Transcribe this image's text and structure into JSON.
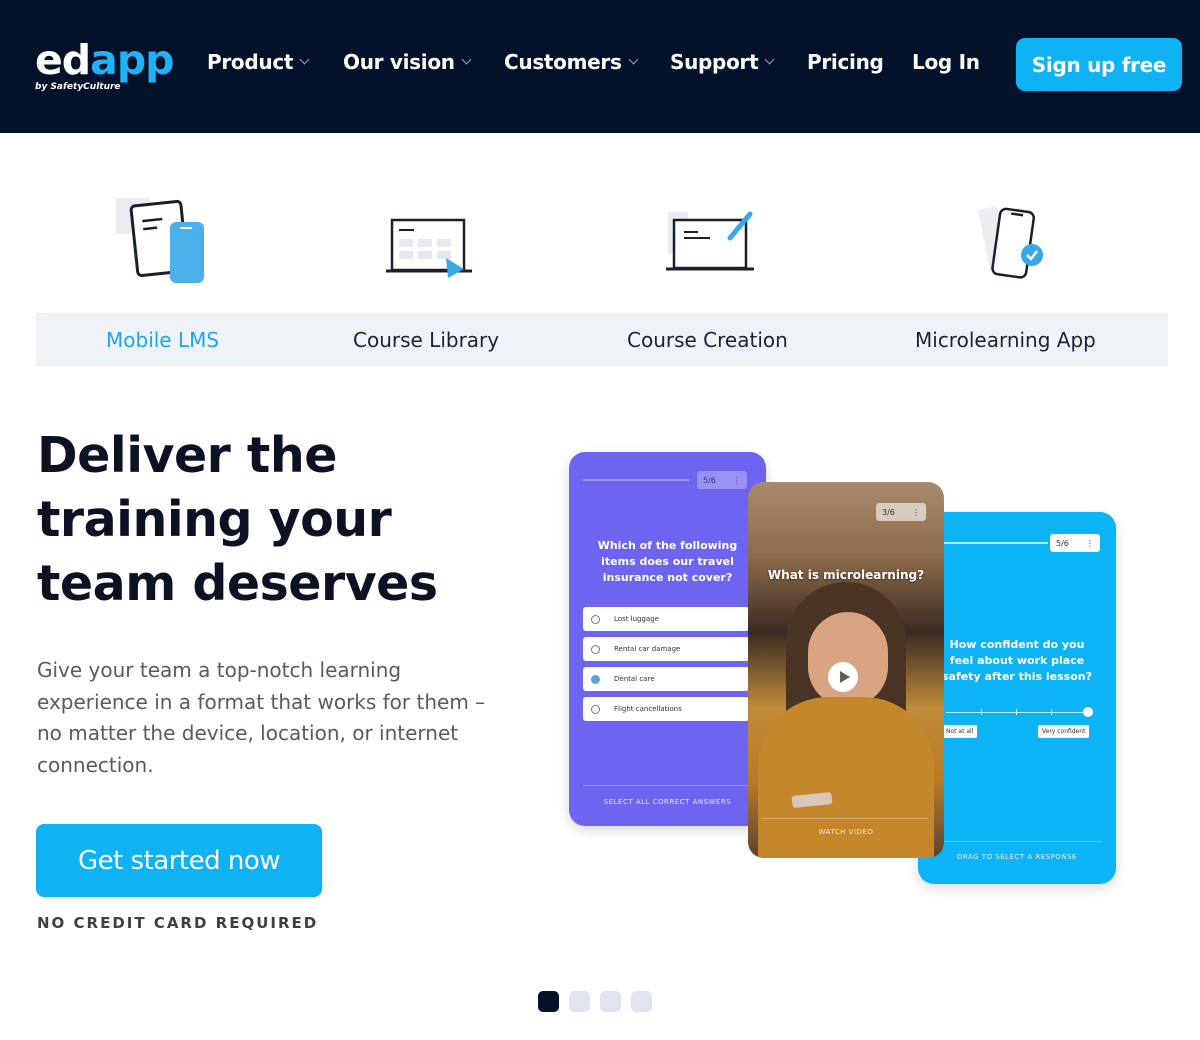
{
  "nav": {
    "logo": {
      "ed": "ed",
      "app": "app",
      "sub": "by SafetyCulture"
    },
    "items": [
      {
        "label": "Product",
        "dropdown": true
      },
      {
        "label": "Our vision",
        "dropdown": true
      },
      {
        "label": "Customers",
        "dropdown": true
      },
      {
        "label": "Support",
        "dropdown": true
      },
      {
        "label": "Pricing",
        "dropdown": false
      },
      {
        "label": "Log In",
        "dropdown": false
      }
    ],
    "signup_label": "Sign up free"
  },
  "product_tabs": [
    {
      "label": "Mobile LMS",
      "icon": "document-phone-icon",
      "active": true
    },
    {
      "label": "Course Library",
      "icon": "laptop-library-icon",
      "active": false
    },
    {
      "label": "Course Creation",
      "icon": "laptop-pen-icon",
      "active": false
    },
    {
      "label": "Microlearning App",
      "icon": "phone-check-icon",
      "active": false
    }
  ],
  "hero": {
    "title_lines": [
      "Deliver the",
      "training your",
      "team deserves"
    ],
    "description": "Give your team a top-notch learning experience in a format that works for them – no matter the device, location, or internet connection.",
    "cta_label": "Get started now",
    "note": "NO CREDIT CARD REQUIRED"
  },
  "cards": {
    "quiz": {
      "counter": "5/6",
      "question": "Which of the following items does our travel insurance not cover?",
      "options": [
        {
          "label": "Lost luggage",
          "checked": false
        },
        {
          "label": "Rental car damage",
          "checked": false
        },
        {
          "label": "Dental care",
          "checked": true
        },
        {
          "label": "Flight cancellations",
          "checked": false
        }
      ],
      "footer": "SELECT ALL CORRECT ANSWERS"
    },
    "video": {
      "counter": "3/6",
      "title": "What is microlearning?",
      "footer": "WATCH VIDEO"
    },
    "slider": {
      "counter": "5/6",
      "question": "How confident do you feel about work place safety after this lesson?",
      "min_label": "Not at all",
      "max_label": "Very confident",
      "value_fraction": 1.0,
      "footer": "DRAG TO SELECT A RESPONSE"
    }
  },
  "carousel": {
    "total": 4,
    "active_index": 0
  },
  "colors": {
    "nav_bg": "#03112b",
    "accent": "#0fb2f2",
    "quiz_card": "#6d64ef",
    "tab_bar": "#eff3f8"
  }
}
